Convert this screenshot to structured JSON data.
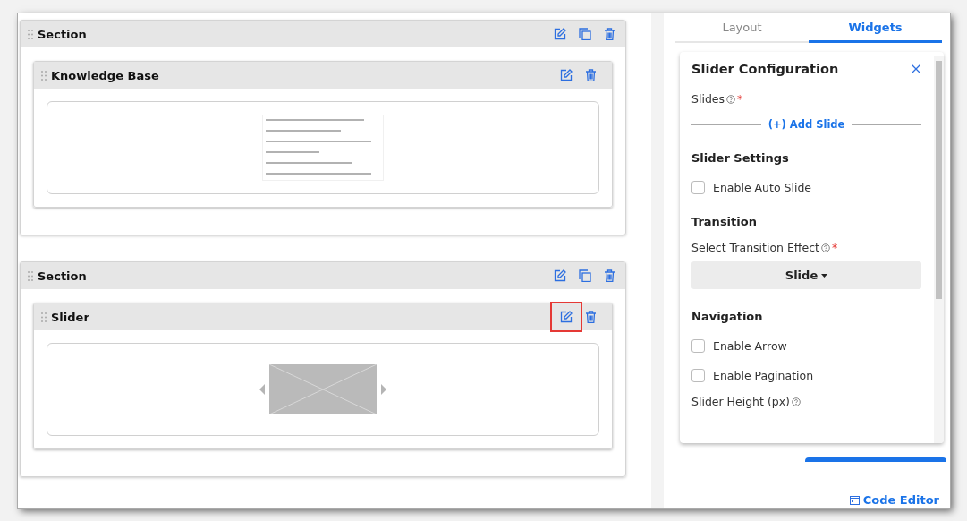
{
  "sections": [
    {
      "title": "Section",
      "widgets": [
        {
          "kind": "knowledge_base",
          "title": "Knowledge Base",
          "edit_highlighted": false
        }
      ]
    },
    {
      "title": "Section",
      "widgets": [
        {
          "kind": "slider",
          "title": "Slider",
          "edit_highlighted": true
        }
      ]
    }
  ],
  "panel": {
    "tabs": [
      {
        "label": "Layout",
        "selected": false
      },
      {
        "label": "Widgets",
        "selected": true
      }
    ],
    "title": "Slider Configuration",
    "fields": [
      {
        "kind": "label",
        "text": "Slides",
        "help": true,
        "required_mark": "*"
      },
      {
        "kind": "add_link",
        "text": "(+) Add Slide"
      },
      {
        "kind": "heading",
        "text": "Slider Settings"
      },
      {
        "kind": "checkbox",
        "text": "Enable Auto Slide",
        "checked": false
      },
      {
        "kind": "heading",
        "text": "Transition"
      },
      {
        "kind": "label",
        "text": "Select Transition Effect",
        "help": true,
        "required_mark": "*"
      },
      {
        "kind": "dropdown",
        "value": "Slide"
      },
      {
        "kind": "heading",
        "text": "Navigation"
      },
      {
        "kind": "checkbox",
        "text": "Enable Arrow",
        "checked": false
      },
      {
        "kind": "checkbox",
        "text": "Enable Pagination",
        "checked": false
      },
      {
        "kind": "label",
        "text": "Slider Height (px)",
        "help": true
      }
    ]
  },
  "code_editor": "Code Editor"
}
